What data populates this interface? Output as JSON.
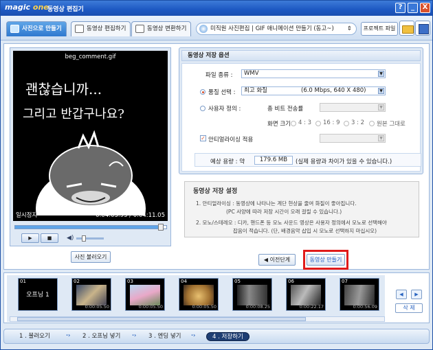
{
  "app": {
    "logo_main": "magic",
    "logo_accent": "one",
    "title": "동영상 편집기"
  },
  "window_buttons": [
    "?",
    "_",
    "X"
  ],
  "toolbar": {
    "tabs": [
      {
        "label": "사진으로 만들기"
      },
      {
        "label": "동영상 편집하기"
      },
      {
        "label": "동영상 변환하기"
      }
    ],
    "menu_text": "미직원 사진편집 | GIF 애니메이션 만들기 (동고~)",
    "menu_arrow": "⇕",
    "project_label": "프로젝트 파일"
  },
  "preview": {
    "filename": "beg_comment.gif",
    "caption_line1": "괜찮습니까...",
    "caption_line2": "그리고 반갑구나요?",
    "state": "일시정지",
    "time": "0:04:03.93 / 0:04:11.05",
    "play": "▶",
    "stop": "■",
    "volume_icon": "◀)",
    "seek_percent": 96,
    "import_label": "사진 불러오기"
  },
  "options": {
    "header": "동영상 저장 옵션",
    "file_type_label": "파일 종류 :",
    "file_type_value": "WMV",
    "quality_label": "품질 선택 :",
    "quality_value": "최고 화질",
    "quality_detail": "(6.0 Mbps, 640 X 480)",
    "custom_label": "사용자 정의 :",
    "bitrate_label": "총 비트 전송률",
    "screen_label": "화면 크기",
    "ratios": [
      "4 : 3",
      "16 : 9",
      "3 : 2",
      "원본 그대로"
    ],
    "antialias_label": "안티얼라이싱 적용",
    "antialias_check": "✓",
    "size_label": "예상 용량 : 약",
    "size_value": "179.6 MB",
    "size_note": "(실제 용량과 차이가 있을 수 있습니다.)"
  },
  "info": {
    "title": "동영상 저장 설정",
    "lines": [
      "1. 안티얼라이싱 : 동영상에 나타나는 계단 현상을 줄여 화질이 좋아집니다.",
      "(PC 사양에 따라 저장 시간이 오래 걸릴 수 있습니다.)",
      "2. 모노/스테레오 : 디카, 핸드폰 등 모노 사운드 영상은 사용자 정의에서 모노로 선택해야",
      "잡음이 적습니다. (단, 배경음악 삽입 시 모노로 선택하지 마십시오)"
    ]
  },
  "nav": {
    "prev_label": "◀ 이전단계",
    "make_label": "동영상 만들기"
  },
  "clips": [
    {
      "num": "01",
      "label": "오프닝 1",
      "dur": ""
    },
    {
      "num": "02",
      "label": "",
      "dur": "0:00:05.50"
    },
    {
      "num": "03",
      "label": "",
      "dur": "0:00:05.50"
    },
    {
      "num": "04",
      "label": "",
      "dur": "0:00:05.50"
    },
    {
      "num": "05",
      "label": "",
      "dur": "0:00:08.25"
    },
    {
      "num": "06",
      "label": "",
      "dur": "0:00:22.17"
    },
    {
      "num": "07",
      "label": "",
      "dur": "0:00:56.09"
    }
  ],
  "strip_controls": {
    "left": "◀",
    "right": "▶",
    "delete": "삭 제"
  },
  "steps": [
    "1 . 불러오기",
    "2 . 오프닝 넣기",
    "3 . 엔딩 넣기",
    "4 . 저장하기"
  ],
  "step_arrow": "·›",
  "colors": {
    "accent": "#1d58c2",
    "highlight": "#e01a1a",
    "panel": "#dfe9f5"
  }
}
